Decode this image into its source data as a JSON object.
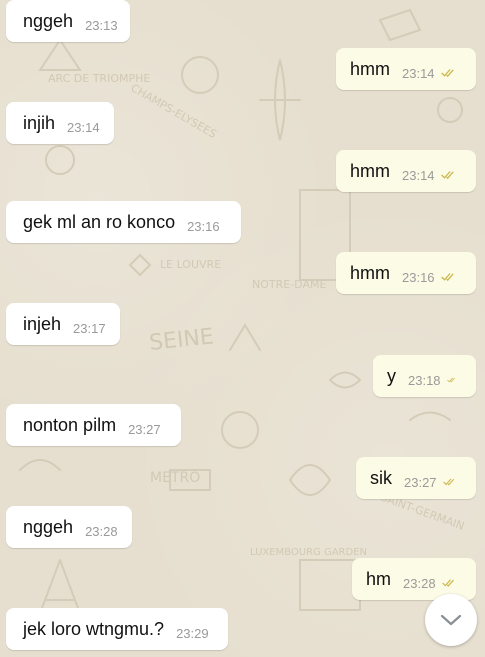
{
  "colors": {
    "incoming_bubble": "#ffffff",
    "outgoing_bubble": "#fcfbe6",
    "read_ticks": "#c9b74a",
    "background": "#e6dfcf"
  },
  "messages": [
    {
      "direction": "in",
      "text": "nggeh",
      "time": "23:13"
    },
    {
      "direction": "out",
      "text": "hmm",
      "time": "23:14",
      "status_icon": "double-check-icon"
    },
    {
      "direction": "in",
      "text": "injih",
      "time": "23:14"
    },
    {
      "direction": "out",
      "text": "hmm",
      "time": "23:14",
      "status_icon": "double-check-icon"
    },
    {
      "direction": "in",
      "text": "gek ml an ro konco",
      "time": "23:16"
    },
    {
      "direction": "out",
      "text": "hmm",
      "time": "23:16",
      "status_icon": "double-check-icon"
    },
    {
      "direction": "in",
      "text": "injeh",
      "time": "23:17"
    },
    {
      "direction": "out",
      "text": "y",
      "time": "23:18",
      "status_icon": "double-check-icon"
    },
    {
      "direction": "in",
      "text": "nonton pilm",
      "time": "23:27"
    },
    {
      "direction": "out",
      "text": "sik",
      "time": "23:27",
      "status_icon": "double-check-icon"
    },
    {
      "direction": "in",
      "text": "nggeh",
      "time": "23:28"
    },
    {
      "direction": "out",
      "text": "hm",
      "time": "23:28",
      "status_icon": "double-check-icon"
    },
    {
      "direction": "in",
      "text": "jek loro wtngmu.?",
      "time": "23:29"
    }
  ],
  "wallpaper": {
    "labels": [
      "ARC DE TRIOMPHE",
      "CHAMPS-ELYSEES",
      "LE LOUVRE",
      "NOTRE-DAME",
      "SEINE",
      "METRO",
      "SAINT-GERMAIN",
      "LUXEMBOURG GARDEN"
    ]
  },
  "scroll_button": {
    "icon": "chevron-down-icon"
  }
}
